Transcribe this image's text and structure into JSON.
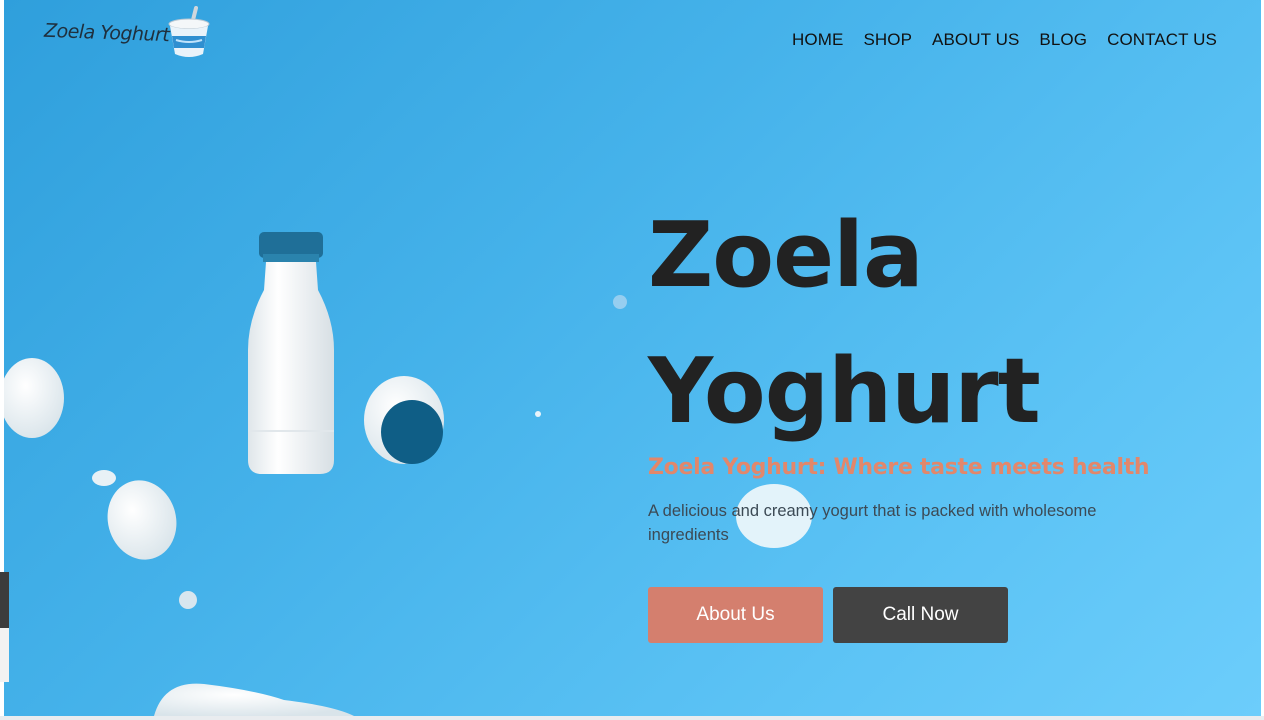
{
  "brand": {
    "logo_text": "Zoela Yoghurt"
  },
  "nav": {
    "items": [
      {
        "label": "HOME"
      },
      {
        "label": "SHOP"
      },
      {
        "label": "ABOUT US"
      },
      {
        "label": "BLOG"
      },
      {
        "label": "CONTACT US"
      }
    ]
  },
  "hero": {
    "title_line1": "Zoela",
    "title_line2": "Yoghurt",
    "tagline": "Zoela Yoghurt: Where taste meets health",
    "description": "A delicious and creamy yogurt that is packed with wholesome ingredients",
    "primary_button": "About Us",
    "secondary_button": "Call Now"
  },
  "colors": {
    "hero_bg": "#45b2ea",
    "title": "#222222",
    "tagline": "#e2876b",
    "primary_button": "#d47f6e",
    "secondary_button": "#434343"
  },
  "icons": {
    "logo": "yoghurt-cup-icon",
    "product": "milk-bottle-image"
  }
}
